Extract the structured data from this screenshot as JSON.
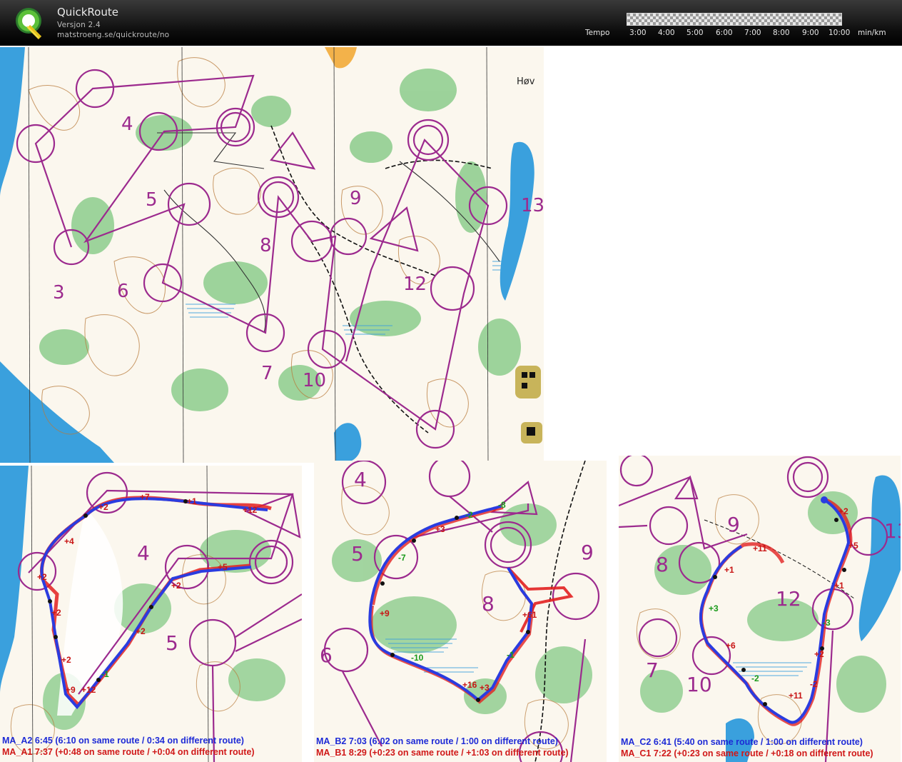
{
  "app": {
    "title": "QuickRoute",
    "version": "Versjon 2.4",
    "url": "matstroeng.se/quickroute/no"
  },
  "pace_scale": {
    "label": "Tempo",
    "ticks": [
      "3:00",
      "4:00",
      "5:00",
      "6:00",
      "7:00",
      "8:00",
      "9:00",
      "10:00"
    ],
    "unit": "min/km"
  },
  "main_map": {
    "controls": [
      "3",
      "4",
      "5",
      "6",
      "7",
      "8",
      "9",
      "10",
      "12",
      "13"
    ],
    "place_label": "Høv"
  },
  "panels": [
    {
      "id": "A",
      "controls": [
        "4",
        "5"
      ],
      "splits": [
        "+2",
        "+7",
        "+1",
        "+12",
        "+4",
        "+2",
        "+5",
        "+2",
        "+2",
        "+2",
        "+2",
        "+9",
        "+12",
        "-1"
      ],
      "legend_blue": "MA_A2 6:45 (6:10 on same route / 0:34 on different route)",
      "legend_red": "MA_A1 7:37 (+0:48 on same route / +0:04 on different route)"
    },
    {
      "id": "B",
      "controls": [
        "4",
        "5",
        "6",
        "8",
        "9"
      ],
      "splits": [
        "-8",
        "-2",
        "+3",
        "-7",
        "+9",
        "+61",
        "-10",
        "+16",
        "+3",
        "-1"
      ],
      "legend_blue": "MA_B2 7:03 (6:02 on same route / 1:00 on different route)",
      "legend_red": "MA_B1 8:29 (+0:23 on same route / +1:03 on different route)"
    },
    {
      "id": "C",
      "controls": [
        "7",
        "8",
        "9",
        "10",
        "12",
        "13"
      ],
      "splits": [
        "+2",
        "+5",
        "+11",
        "+1",
        "+1",
        "+3",
        "-3",
        "+6",
        "+2",
        "-2",
        "+11",
        "-2"
      ],
      "legend_blue": "MA_C2 6:41 (5:40 on same route / 1:00 on different route)",
      "legend_red": "MA_C1 7:22 (+0:23 on same route / +0:18 on different route)"
    }
  ],
  "colors": {
    "course": "#9c2a8e",
    "route_blue": "#2a3ce0",
    "route_red": "#e22020",
    "split_red": "#c81414",
    "split_green": "#1a9a1a",
    "water": "#3aa0dd",
    "veg_green": "#8ccc8c",
    "contour": "#b87a3a"
  }
}
